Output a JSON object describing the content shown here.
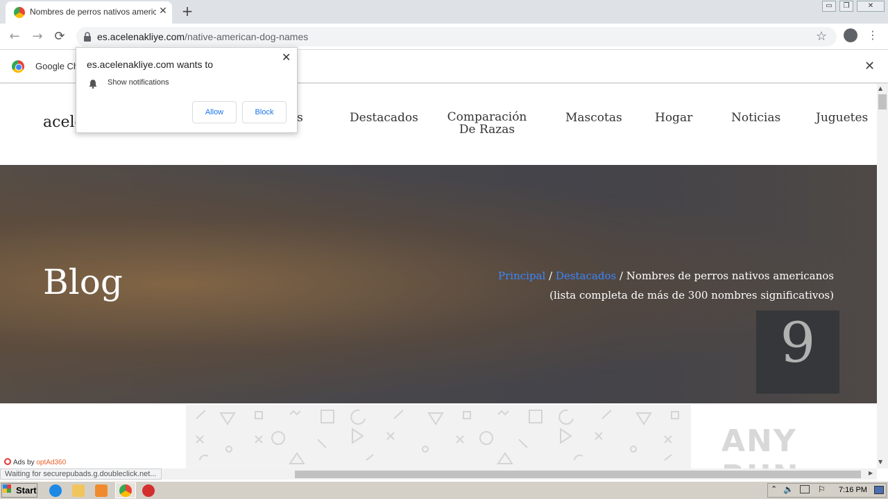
{
  "browser": {
    "tab_title": "Nombres de perros nativos americanos",
    "tab_close": "✕",
    "new_tab": "+",
    "url_host": "es.acelenakliye.com",
    "url_path": "/native-american-dog-names",
    "window_controls": [
      "▭",
      "❐",
      "✕"
    ]
  },
  "infobar": {
    "text": "Google Ch",
    "close": "✕"
  },
  "popup": {
    "title": "es.acelenakliye.com wants to",
    "permission": "Show notifications",
    "allow": "Allow",
    "block": "Block",
    "close": "✕"
  },
  "site": {
    "logo": "acele",
    "nav": [
      "as",
      "Destacados",
      "Comparación\nDe Razas",
      "Mascotas",
      "Hogar",
      "Noticias",
      "Juguetes"
    ]
  },
  "hero": {
    "title": "Blog",
    "breadcrumb": {
      "home": "Principal",
      "section": "Destacados",
      "separator": "/",
      "current": "Nombres de perros nativos americanos (lista completa de más de 300 nombres significativos)"
    },
    "number": "9"
  },
  "ads": {
    "prefix": "Ads by ",
    "brand": "optAd360"
  },
  "status_bar": "Waiting for securepubads.g.doubleclick.net...",
  "watermark": "ANY RUN",
  "taskbar": {
    "start": "Start",
    "clock": "7:16 PM"
  }
}
